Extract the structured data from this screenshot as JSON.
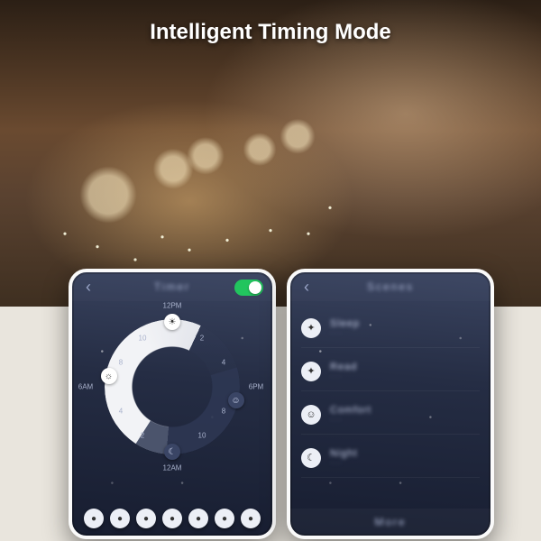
{
  "title": "Intelligent Timing Mode",
  "leftPhone": {
    "header": "Timer",
    "toggleOn": true,
    "dial": {
      "labels": {
        "top": "12PM",
        "right": "6PM",
        "bottom": "12AM",
        "left": "6AM"
      },
      "ticks": [
        "2",
        "4",
        "6",
        "8",
        "10",
        "2",
        "4",
        "6",
        "8",
        "10"
      ],
      "icons": {
        "sun": "☀",
        "sunrise": "☼",
        "moon": "☾",
        "smile": "☺"
      }
    },
    "presetCount": 7,
    "presetGlyph": "●"
  },
  "rightPhone": {
    "header": "Scenes",
    "items": [
      {
        "icon": "✦",
        "label": "Sleep",
        "sub": "· · ·"
      },
      {
        "icon": "✦",
        "label": "Read",
        "sub": "· · ·"
      },
      {
        "icon": "☺",
        "label": "Comfort",
        "sub": "· · ·"
      },
      {
        "icon": "☾",
        "label": "Night",
        "sub": "· · ·"
      }
    ],
    "footer": "More"
  }
}
